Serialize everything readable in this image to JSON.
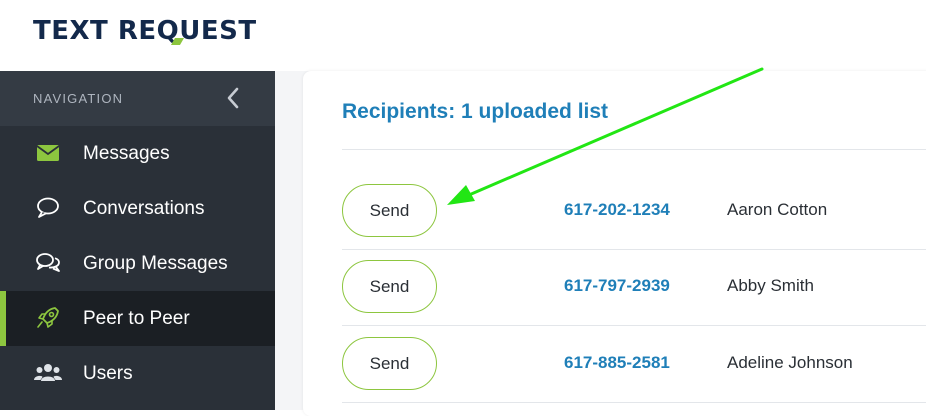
{
  "header": {
    "logo_text_a": "TEXT RE",
    "logo_text_q": "Q",
    "logo_text_b": "UEST"
  },
  "sidebar": {
    "heading": "NAVIGATION",
    "items": [
      {
        "label": "Messages",
        "icon": "envelope-icon",
        "active": false
      },
      {
        "label": "Conversations",
        "icon": "speech-bubble-icon",
        "active": false
      },
      {
        "label": "Group Messages",
        "icon": "group-chat-icon",
        "active": false
      },
      {
        "label": "Peer to Peer",
        "icon": "rocket-icon",
        "active": true
      },
      {
        "label": "Users",
        "icon": "users-icon",
        "active": false
      }
    ]
  },
  "main": {
    "title": "Recipients: 1 uploaded list",
    "recipients": [
      {
        "send_label": "Send",
        "phone": "617-202-1234",
        "name": "Aaron Cotton"
      },
      {
        "send_label": "Send",
        "phone": "617-797-2939",
        "name": "Abby Smith"
      },
      {
        "send_label": "Send",
        "phone": "617-885-2581",
        "name": "Adeline Johnson"
      }
    ]
  },
  "annotation": {
    "arrow_color": "#22e614"
  },
  "colors": {
    "brand_navy": "#13294b",
    "brand_green": "#8dc63f",
    "link_blue": "#1f7fb8",
    "sidebar_bg": "#2a3038",
    "sidebar_active_bg": "#1b1f24"
  }
}
